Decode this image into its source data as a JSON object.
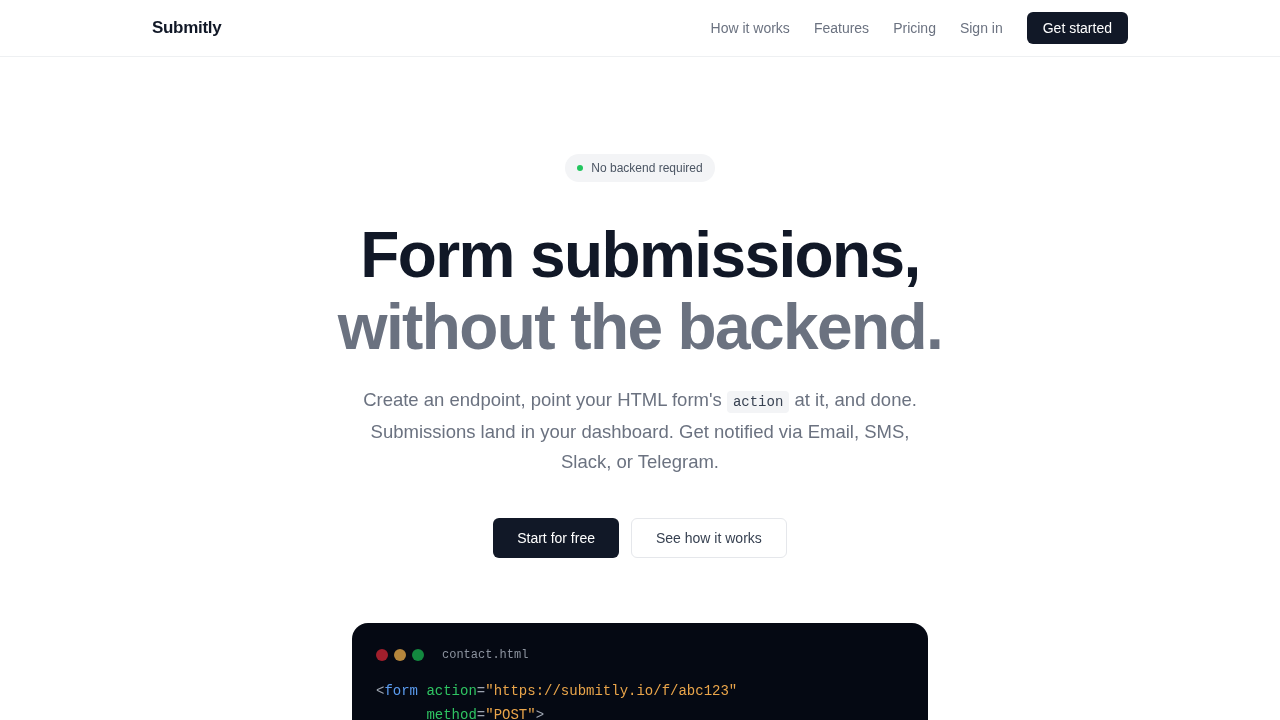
{
  "nav": {
    "logo": "Submitly",
    "links": [
      "How it works",
      "Features",
      "Pricing",
      "Sign in"
    ],
    "cta": "Get started"
  },
  "hero": {
    "badge": "No backend required",
    "heading_lines": [
      {
        "kind": "strong",
        "text": "Form submissions,"
      },
      {
        "kind": "muted",
        "text": "without the backend."
      }
    ],
    "description": [
      {
        "kind": "text",
        "text": "Create an endpoint, point your HTML form's "
      },
      {
        "kind": "code",
        "text": "action"
      },
      {
        "kind": "text",
        "text": " at it, and done. Submissions land in your dashboard. Get notified via Email, SMS, Slack, or Telegram."
      }
    ],
    "buttons": [
      {
        "kind": "primary",
        "label": "Start for free"
      },
      {
        "kind": "secondary",
        "label": "See how it works"
      }
    ]
  },
  "code_window": {
    "filename": "contact.html",
    "lines": [
      {
        "tokens": [
          {
            "kind": "punct",
            "text": "<"
          },
          {
            "kind": "tag",
            "text": "form"
          },
          {
            "kind": "attr",
            "text": " action"
          },
          {
            "kind": "punct",
            "text": "="
          },
          {
            "kind": "string",
            "text": "\"https://submitly.io/f/abc123\""
          }
        ]
      },
      {
        "tokens": [
          {
            "kind": "attr",
            "text": "      method"
          },
          {
            "kind": "punct",
            "text": "="
          },
          {
            "kind": "string",
            "text": "\"POST\""
          },
          {
            "kind": "punct",
            "text": ">"
          }
        ]
      }
    ]
  }
}
